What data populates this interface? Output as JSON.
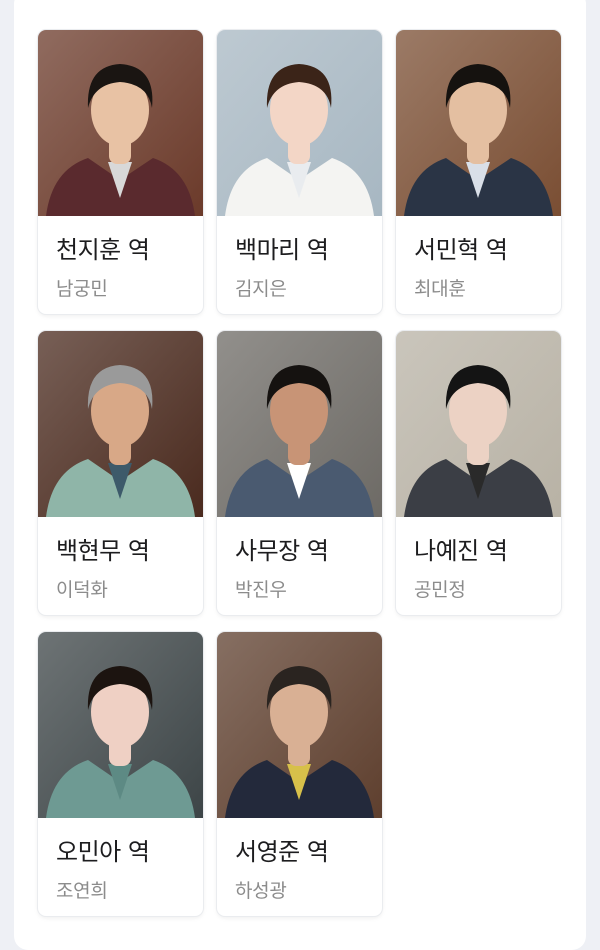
{
  "cast": [
    {
      "role": "천지훈 역",
      "actor": "남궁민",
      "bg": "#6b3a2a",
      "suit": "#5a2a2e",
      "hair": "#1a1512",
      "skin": "#e8c2a4",
      "accent": "#d8d8d8"
    },
    {
      "role": "백마리 역",
      "actor": "김지은",
      "bg": "#a7b7c2",
      "suit": "#f4f4f2",
      "hair": "#3b2418",
      "skin": "#f3d6c6",
      "accent": "#e9ecef"
    },
    {
      "role": "서민혁 역",
      "actor": "최대훈",
      "bg": "#7a4e33",
      "suit": "#2a3445",
      "hair": "#15120f",
      "skin": "#e4bfa1",
      "accent": "#d9dfe8"
    },
    {
      "role": "백현무 역",
      "actor": "이덕화",
      "bg": "#4a2a1e",
      "suit": "#8fb5a8",
      "hair": "#9a9a9a",
      "skin": "#d8a887",
      "accent": "#3d5a6a"
    },
    {
      "role": "사무장 역",
      "actor": "박진우",
      "bg": "#6d6a65",
      "suit": "#4a5a70",
      "hair": "#151210",
      "skin": "#c89476",
      "accent": "#ffffff"
    },
    {
      "role": "나예진 역",
      "actor": "공민정",
      "bg": "#b8b2a5",
      "suit": "#3b3e45",
      "hair": "#141414",
      "skin": "#ecd2c4",
      "accent": "#2a2a2a"
    },
    {
      "role": "오민아 역",
      "actor": "조연희",
      "bg": "#3d4547",
      "suit": "#6e9a93",
      "hair": "#1c1410",
      "skin": "#efd0c4",
      "accent": "#5d8a84"
    },
    {
      "role": "서영준 역",
      "actor": "하성광",
      "bg": "#5e3f2e",
      "suit": "#23293b",
      "hair": "#2a2420",
      "skin": "#d9b094",
      "accent": "#d7c04a"
    }
  ]
}
